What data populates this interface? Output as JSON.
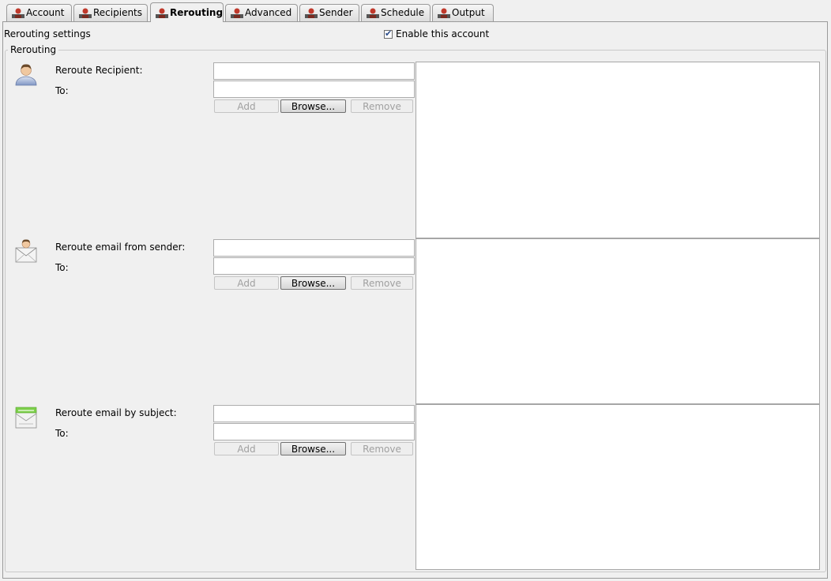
{
  "tabs": [
    {
      "label": "Account",
      "active": false
    },
    {
      "label": "Recipients",
      "active": false
    },
    {
      "label": "Rerouting",
      "active": true
    },
    {
      "label": "Advanced",
      "active": false
    },
    {
      "label": "Sender",
      "active": false
    },
    {
      "label": "Schedule",
      "active": false
    },
    {
      "label": "Output",
      "active": false
    }
  ],
  "header": {
    "section_title": "Rerouting settings",
    "enable_label": "Enable this account",
    "enable_checked": true
  },
  "group": {
    "legend": "Rerouting",
    "sections": [
      {
        "icon": "user-icon",
        "source_label": "Reroute Recipient:",
        "to_label": "To:",
        "source_value": "",
        "to_value": "",
        "add_label": "Add",
        "browse_label": "Browse...",
        "remove_label": "Remove"
      },
      {
        "icon": "sender-envelope-icon",
        "source_label": "Reroute email from sender:",
        "to_label": "To:",
        "source_value": "",
        "to_value": "",
        "add_label": "Add",
        "browse_label": "Browse...",
        "remove_label": "Remove"
      },
      {
        "icon": "subject-envelope-icon",
        "source_label": "Reroute email by subject:",
        "to_label": "To:",
        "source_value": "",
        "to_value": "",
        "add_label": "Add",
        "browse_label": "Browse...",
        "remove_label": "Remove"
      }
    ]
  }
}
